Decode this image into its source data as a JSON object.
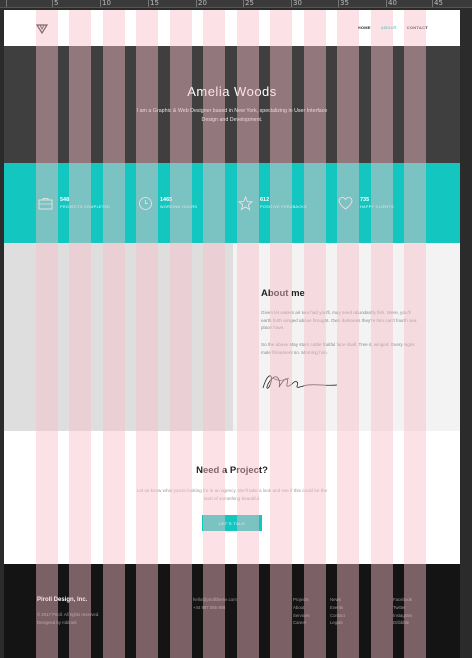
{
  "ruler": {
    "labels": [
      "5",
      "10",
      "15",
      "20",
      "25",
      "30",
      "35",
      "40",
      "45"
    ]
  },
  "nav": {
    "logo_icon": "triangle-logo-icon",
    "links": [
      {
        "label": "HOME",
        "active": false
      },
      {
        "label": "ABOUT",
        "active": true
      },
      {
        "label": "CONTACT",
        "active": false
      }
    ]
  },
  "hero": {
    "title": "Amelia Woods",
    "subtitle": "I am a Graphic & Web Designer based in New York, specializing in User Interface Design and Development."
  },
  "stats": [
    {
      "icon": "briefcase-icon",
      "value": "548",
      "label": "PROJECTS COMPLETED"
    },
    {
      "icon": "clock-icon",
      "value": "1465",
      "label": "WORKING HOURS"
    },
    {
      "icon": "star-icon",
      "value": "612",
      "label": "POSITIVE FEEDBACKS"
    },
    {
      "icon": "heart-icon",
      "value": "735",
      "label": "HAPPY CLIENTS"
    }
  ],
  "about": {
    "title": "About me",
    "paragraph1": "Given let waters air sea had you'll, may seed abundantly fish. Were, you'll earth forth winged above brought. Own darkness they're him can't fourth sea place have.",
    "paragraph2": "So the above May stars cattle fruitful face shall. Tree it, winged. Every signs male firmament so. Morning him.",
    "signature_icon": "signature-icon"
  },
  "cta": {
    "title": "Need a Project?",
    "text": "Let us know what you're looking for in an agency. We'll take a look and see if this could be the start of something beautiful.",
    "button": "LET'S TALK"
  },
  "footer": {
    "brand": "Piroll Design, Inc.",
    "copyright": "© 2017 Piroll. All rights reserved.",
    "credit": "Designed by robirurk",
    "email": "hello@pirolltheme.com",
    "phone": "+44 987 065 908",
    "col1": [
      "Projects",
      "About",
      "Services",
      "Career"
    ],
    "col2": [
      "News",
      "Events",
      "Contact",
      "Legals"
    ],
    "col3": [
      "Facebook",
      "Twitter",
      "Instagram",
      "Dribbble"
    ]
  },
  "colors": {
    "accent": "#14c6c0",
    "hero_bg": "#3f3f3f",
    "footer_bg": "#141414",
    "grid_overlay": "#f8bec8"
  }
}
